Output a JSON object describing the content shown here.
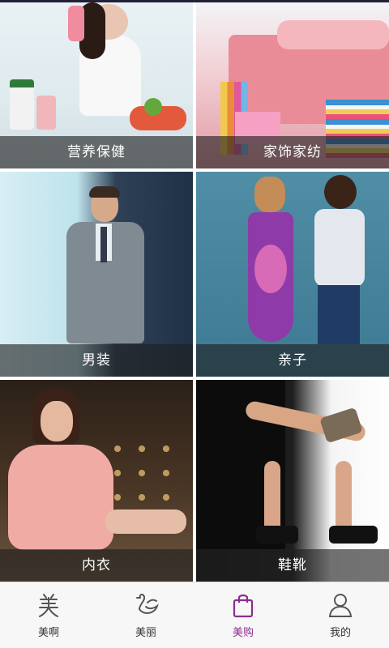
{
  "categories": [
    {
      "label": "营养保健"
    },
    {
      "label": "家饰家纺"
    },
    {
      "label": "男装"
    },
    {
      "label": "亲子"
    },
    {
      "label": "内衣"
    },
    {
      "label": "鞋靴"
    }
  ],
  "nav": {
    "items": [
      {
        "label": "美啊",
        "icon": "mei-character-icon"
      },
      {
        "label": "美丽",
        "icon": "swan-icon"
      },
      {
        "label": "美购",
        "icon": "shopping-bag-icon"
      },
      {
        "label": "我的",
        "icon": "user-icon"
      }
    ],
    "active_index": 2
  },
  "colors": {
    "accent": "#8b2d8f",
    "nav_text": "#333333",
    "label_overlay": "rgba(30,30,30,0.62)"
  }
}
